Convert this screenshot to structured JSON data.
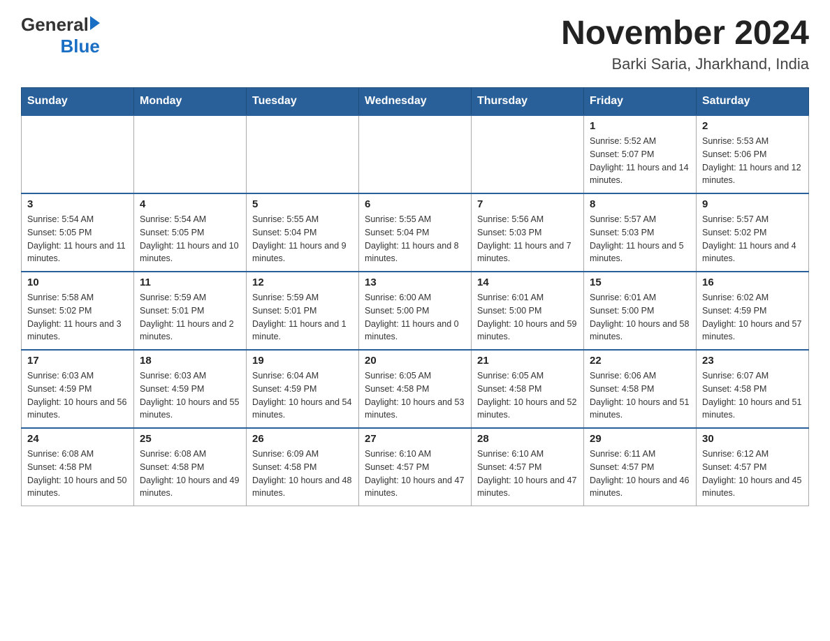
{
  "header": {
    "logo": {
      "general": "General",
      "arrow": "▶",
      "blue": "Blue"
    },
    "title": "November 2024",
    "subtitle": "Barki Saria, Jharkhand, India"
  },
  "weekdays": [
    "Sunday",
    "Monday",
    "Tuesday",
    "Wednesday",
    "Thursday",
    "Friday",
    "Saturday"
  ],
  "weeks": [
    [
      {
        "day": "",
        "info": ""
      },
      {
        "day": "",
        "info": ""
      },
      {
        "day": "",
        "info": ""
      },
      {
        "day": "",
        "info": ""
      },
      {
        "day": "",
        "info": ""
      },
      {
        "day": "1",
        "info": "Sunrise: 5:52 AM\nSunset: 5:07 PM\nDaylight: 11 hours and 14 minutes."
      },
      {
        "day": "2",
        "info": "Sunrise: 5:53 AM\nSunset: 5:06 PM\nDaylight: 11 hours and 12 minutes."
      }
    ],
    [
      {
        "day": "3",
        "info": "Sunrise: 5:54 AM\nSunset: 5:05 PM\nDaylight: 11 hours and 11 minutes."
      },
      {
        "day": "4",
        "info": "Sunrise: 5:54 AM\nSunset: 5:05 PM\nDaylight: 11 hours and 10 minutes."
      },
      {
        "day": "5",
        "info": "Sunrise: 5:55 AM\nSunset: 5:04 PM\nDaylight: 11 hours and 9 minutes."
      },
      {
        "day": "6",
        "info": "Sunrise: 5:55 AM\nSunset: 5:04 PM\nDaylight: 11 hours and 8 minutes."
      },
      {
        "day": "7",
        "info": "Sunrise: 5:56 AM\nSunset: 5:03 PM\nDaylight: 11 hours and 7 minutes."
      },
      {
        "day": "8",
        "info": "Sunrise: 5:57 AM\nSunset: 5:03 PM\nDaylight: 11 hours and 5 minutes."
      },
      {
        "day": "9",
        "info": "Sunrise: 5:57 AM\nSunset: 5:02 PM\nDaylight: 11 hours and 4 minutes."
      }
    ],
    [
      {
        "day": "10",
        "info": "Sunrise: 5:58 AM\nSunset: 5:02 PM\nDaylight: 11 hours and 3 minutes."
      },
      {
        "day": "11",
        "info": "Sunrise: 5:59 AM\nSunset: 5:01 PM\nDaylight: 11 hours and 2 minutes."
      },
      {
        "day": "12",
        "info": "Sunrise: 5:59 AM\nSunset: 5:01 PM\nDaylight: 11 hours and 1 minute."
      },
      {
        "day": "13",
        "info": "Sunrise: 6:00 AM\nSunset: 5:00 PM\nDaylight: 11 hours and 0 minutes."
      },
      {
        "day": "14",
        "info": "Sunrise: 6:01 AM\nSunset: 5:00 PM\nDaylight: 10 hours and 59 minutes."
      },
      {
        "day": "15",
        "info": "Sunrise: 6:01 AM\nSunset: 5:00 PM\nDaylight: 10 hours and 58 minutes."
      },
      {
        "day": "16",
        "info": "Sunrise: 6:02 AM\nSunset: 4:59 PM\nDaylight: 10 hours and 57 minutes."
      }
    ],
    [
      {
        "day": "17",
        "info": "Sunrise: 6:03 AM\nSunset: 4:59 PM\nDaylight: 10 hours and 56 minutes."
      },
      {
        "day": "18",
        "info": "Sunrise: 6:03 AM\nSunset: 4:59 PM\nDaylight: 10 hours and 55 minutes."
      },
      {
        "day": "19",
        "info": "Sunrise: 6:04 AM\nSunset: 4:59 PM\nDaylight: 10 hours and 54 minutes."
      },
      {
        "day": "20",
        "info": "Sunrise: 6:05 AM\nSunset: 4:58 PM\nDaylight: 10 hours and 53 minutes."
      },
      {
        "day": "21",
        "info": "Sunrise: 6:05 AM\nSunset: 4:58 PM\nDaylight: 10 hours and 52 minutes."
      },
      {
        "day": "22",
        "info": "Sunrise: 6:06 AM\nSunset: 4:58 PM\nDaylight: 10 hours and 51 minutes."
      },
      {
        "day": "23",
        "info": "Sunrise: 6:07 AM\nSunset: 4:58 PM\nDaylight: 10 hours and 51 minutes."
      }
    ],
    [
      {
        "day": "24",
        "info": "Sunrise: 6:08 AM\nSunset: 4:58 PM\nDaylight: 10 hours and 50 minutes."
      },
      {
        "day": "25",
        "info": "Sunrise: 6:08 AM\nSunset: 4:58 PM\nDaylight: 10 hours and 49 minutes."
      },
      {
        "day": "26",
        "info": "Sunrise: 6:09 AM\nSunset: 4:58 PM\nDaylight: 10 hours and 48 minutes."
      },
      {
        "day": "27",
        "info": "Sunrise: 6:10 AM\nSunset: 4:57 PM\nDaylight: 10 hours and 47 minutes."
      },
      {
        "day": "28",
        "info": "Sunrise: 6:10 AM\nSunset: 4:57 PM\nDaylight: 10 hours and 47 minutes."
      },
      {
        "day": "29",
        "info": "Sunrise: 6:11 AM\nSunset: 4:57 PM\nDaylight: 10 hours and 46 minutes."
      },
      {
        "day": "30",
        "info": "Sunrise: 6:12 AM\nSunset: 4:57 PM\nDaylight: 10 hours and 45 minutes."
      }
    ]
  ]
}
